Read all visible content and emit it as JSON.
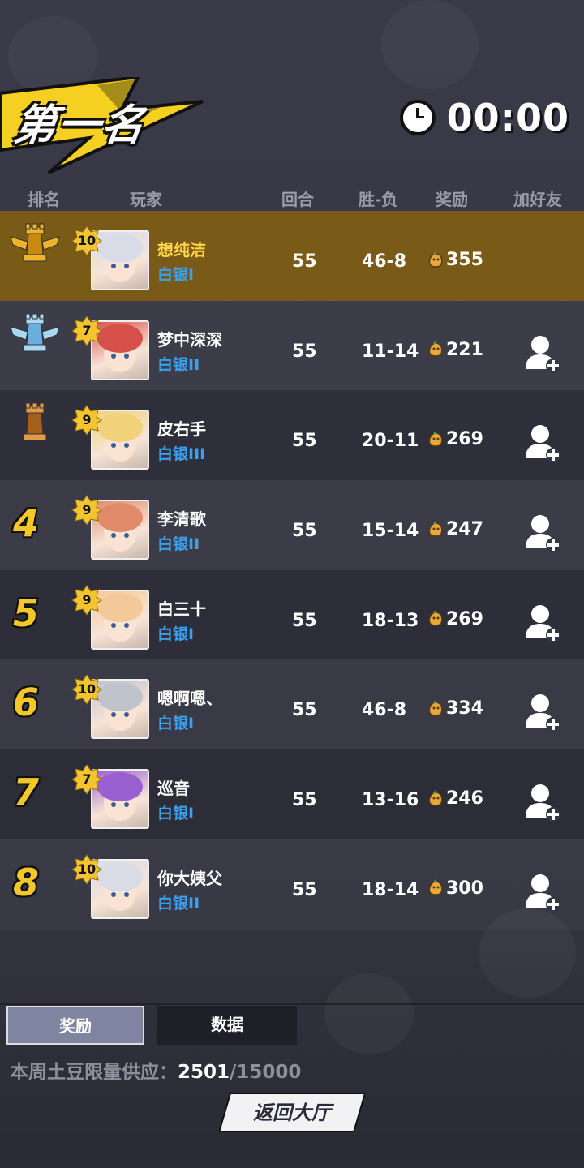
{
  "header": {
    "title": "第一名",
    "timer": "00:00"
  },
  "table_header": {
    "rank": "排名",
    "player": "玩家",
    "rounds": "回合",
    "win_loss": "胜-负",
    "reward": "奖励",
    "add_friend": "加好友"
  },
  "rows": [
    {
      "rank": "1",
      "rank_icon": "gold-rook-icon",
      "level": "10",
      "name": "想纯洁",
      "tier": "白银I",
      "rounds": "55",
      "wl": "46-8",
      "reward": "355",
      "avatar_color": "#d9dce6",
      "can_add": false
    },
    {
      "rank": "2",
      "rank_icon": "silver-rook-icon",
      "level": "7",
      "name": "梦中深深",
      "tier": "白银II",
      "rounds": "55",
      "wl": "11-14",
      "reward": "221",
      "avatar_color": "#d8504a",
      "can_add": true
    },
    {
      "rank": "3",
      "rank_icon": "bronze-rook-icon",
      "level": "9",
      "name": "皮右手",
      "tier": "白银III",
      "rounds": "55",
      "wl": "20-11",
      "reward": "269",
      "avatar_color": "#f1d27a",
      "can_add": true
    },
    {
      "rank": "4",
      "level": "9",
      "name": "李清歌",
      "tier": "白银II",
      "rounds": "55",
      "wl": "15-14",
      "reward": "247",
      "avatar_color": "#e08a6a",
      "can_add": true
    },
    {
      "rank": "5",
      "level": "9",
      "name": "白三十",
      "tier": "白银I",
      "rounds": "55",
      "wl": "18-13",
      "reward": "269",
      "avatar_color": "#f4c99a",
      "can_add": true
    },
    {
      "rank": "6",
      "level": "10",
      "name": "嗯啊嗯、",
      "tier": "白银I",
      "rounds": "55",
      "wl": "46-8",
      "reward": "334",
      "avatar_color": "#bfc3cc",
      "can_add": true
    },
    {
      "rank": "7",
      "level": "7",
      "name": "巡音",
      "tier": "白银I",
      "rounds": "55",
      "wl": "13-16",
      "reward": "246",
      "avatar_color": "#9a5fd0",
      "can_add": true
    },
    {
      "rank": "8",
      "level": "10",
      "name": "你大姨父",
      "tier": "白银II",
      "rounds": "55",
      "wl": "18-14",
      "reward": "300",
      "avatar_color": "#d9dce6",
      "can_add": true
    }
  ],
  "tabs": {
    "reward": "奖励",
    "data": "数据"
  },
  "supply": {
    "label": "本周土豆限量供应：",
    "current": "2501",
    "total": "/15000"
  },
  "back_button": "返回大厅",
  "colors": {
    "first_row": "#7a5a17",
    "gold": "#f3c62a",
    "tier_blue": "#3aa0f0"
  }
}
